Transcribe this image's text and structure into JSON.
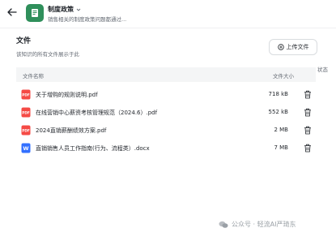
{
  "header": {
    "kb_title": "制度政策",
    "kb_description": "销售相关的制度政策问题都通过..."
  },
  "section": {
    "title": "文件",
    "subtitle": "该知识的所有文件展示于此",
    "upload_label": "上传文件"
  },
  "table": {
    "columns": {
      "name": "文件名称",
      "size": "文件大小",
      "status": "状态"
    },
    "rows": [
      {
        "name": "关于增购的规则说明.pdf",
        "size": "718 kB",
        "type": "pdf"
      },
      {
        "name": "在线营销中心薪资考核管理规范（2024.6）.pdf",
        "size": "552 kB",
        "type": "pdf"
      },
      {
        "name": "2024直销薪酬绩效方案.pdf",
        "size": "2 MB",
        "type": "pdf"
      },
      {
        "name": "直销销售人员工作指南(行为、流程类）.docx",
        "size": "7 MB",
        "type": "docx"
      }
    ]
  },
  "watermark": {
    "text": "公众号 · 轻流AI严琦东"
  },
  "colors": {
    "pdf": "#f54a45",
    "docx": "#3370ff",
    "kb_icon": "#2f8f5b"
  }
}
